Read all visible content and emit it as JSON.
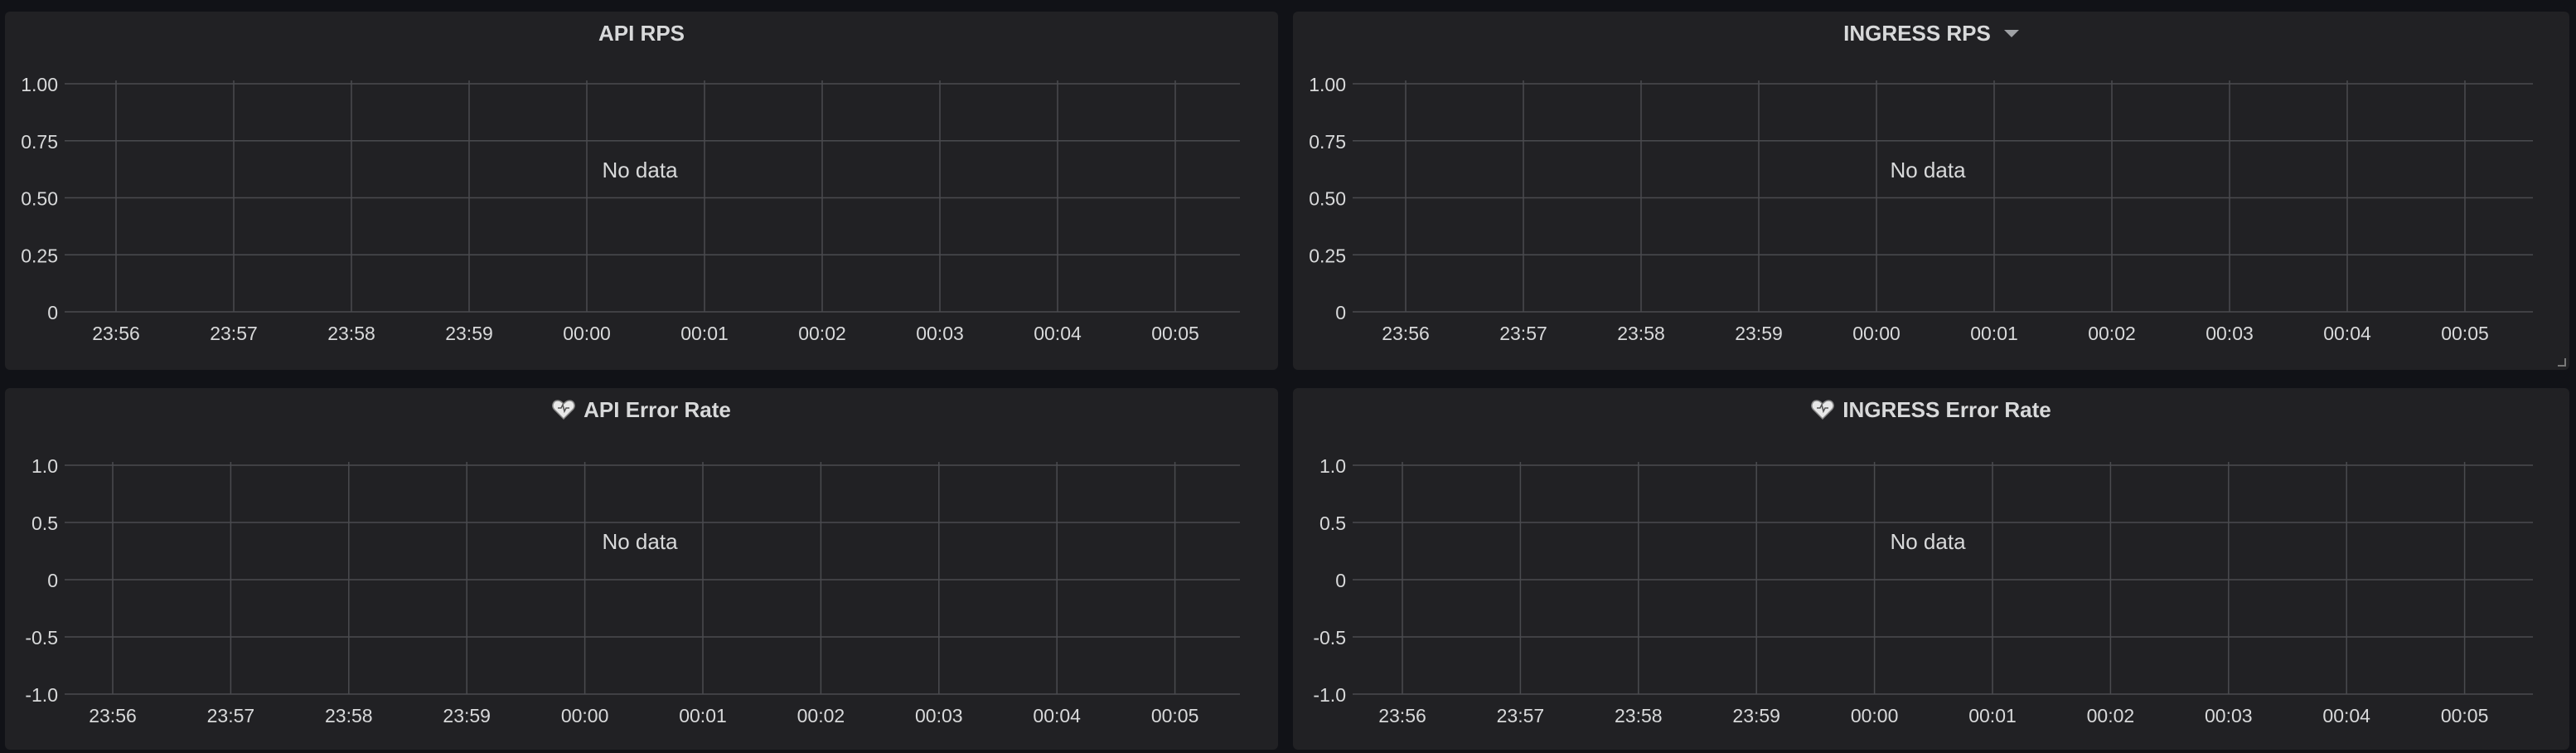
{
  "panels": [
    {
      "title": "API RPS",
      "has_menu_caret": false,
      "has_heart_icon": false,
      "empty_message": "No data",
      "chart_data": {
        "type": "line",
        "title": "API RPS",
        "x_ticks": [
          "23:56",
          "23:57",
          "23:58",
          "23:59",
          "00:00",
          "00:01",
          "00:02",
          "00:03",
          "00:04",
          "00:05"
        ],
        "y_ticks": [
          "1.00",
          "0.75",
          "0.50",
          "0.25",
          "0"
        ],
        "ylim": [
          0,
          1
        ],
        "series": [],
        "grid": true
      }
    },
    {
      "title": "INGRESS RPS",
      "has_menu_caret": true,
      "has_heart_icon": false,
      "empty_message": "No data",
      "chart_data": {
        "type": "line",
        "title": "INGRESS RPS",
        "x_ticks": [
          "23:56",
          "23:57",
          "23:58",
          "23:59",
          "00:00",
          "00:01",
          "00:02",
          "00:03",
          "00:04",
          "00:05"
        ],
        "y_ticks": [
          "1.00",
          "0.75",
          "0.50",
          "0.25",
          "0"
        ],
        "ylim": [
          0,
          1
        ],
        "series": [],
        "grid": true
      }
    },
    {
      "title": "API Error Rate",
      "has_menu_caret": false,
      "has_heart_icon": true,
      "empty_message": "No data",
      "chart_data": {
        "type": "line",
        "title": "API Error Rate",
        "x_ticks": [
          "23:56",
          "23:57",
          "23:58",
          "23:59",
          "00:00",
          "00:01",
          "00:02",
          "00:03",
          "00:04",
          "00:05"
        ],
        "y_ticks": [
          "1.0",
          "0.5",
          "0",
          "-0.5",
          "-1.0"
        ],
        "ylim": [
          -1,
          1
        ],
        "series": [],
        "grid": true
      }
    },
    {
      "title": "INGRESS Error Rate",
      "has_menu_caret": false,
      "has_heart_icon": true,
      "empty_message": "No data",
      "chart_data": {
        "type": "line",
        "title": "INGRESS Error Rate",
        "x_ticks": [
          "23:56",
          "23:57",
          "23:58",
          "23:59",
          "00:00",
          "00:01",
          "00:02",
          "00:03",
          "00:04",
          "00:05"
        ],
        "y_ticks": [
          "1.0",
          "0.5",
          "0",
          "-0.5",
          "-1.0"
        ],
        "ylim": [
          -1,
          1
        ],
        "series": [],
        "grid": true
      }
    }
  ],
  "colors": {
    "background": "#111217",
    "panel": "#212124",
    "grid": "#4a4b4f",
    "text": "#d8d9da",
    "heart_icon": "#e8e8e8"
  }
}
